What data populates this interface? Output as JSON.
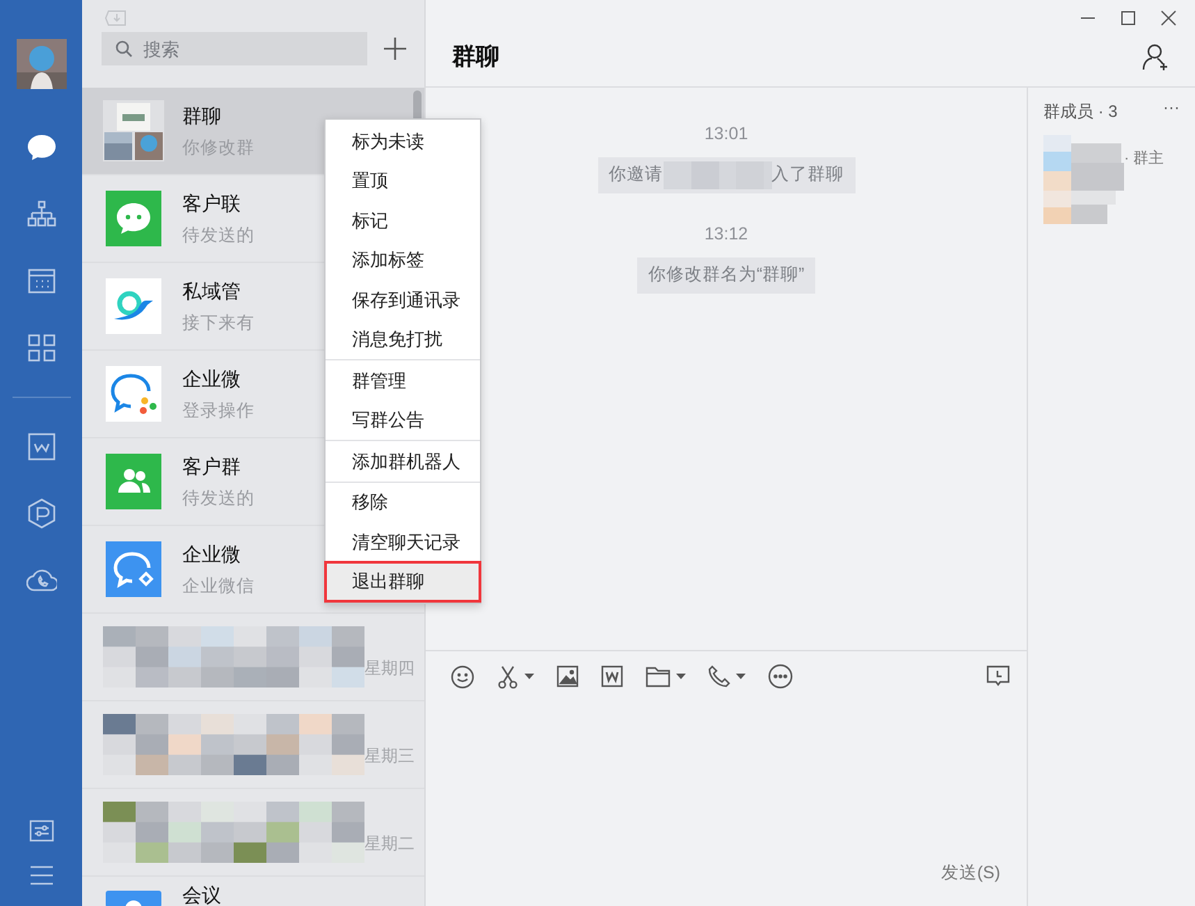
{
  "rail": {
    "items": [
      {
        "selected": true
      },
      {
        "selected": false
      },
      {
        "selected": false
      },
      {
        "selected": false
      },
      {
        "selected": false
      },
      {
        "selected": false
      },
      {
        "selected": false
      }
    ]
  },
  "search": {
    "placeholder": "搜索"
  },
  "chats": [
    {
      "kind": "group",
      "name": "群聊",
      "preview": "你修改群",
      "selected": true
    },
    {
      "kind": "chat",
      "name": "客户联",
      "preview": "待发送的",
      "selected": false
    },
    {
      "kind": "bird",
      "name": "私域管",
      "preview": "接下来有",
      "selected": false
    },
    {
      "kind": "bubble",
      "name": "企业微",
      "preview": "登录操作",
      "selected": false
    },
    {
      "kind": "people",
      "name": "客户群",
      "preview": "待发送的",
      "selected": false
    },
    {
      "kind": "bubble-blue",
      "name": "企业微",
      "preview": "企业微信",
      "selected": false
    },
    {
      "kind": "blurred",
      "time": "星期四",
      "selected": false
    },
    {
      "kind": "blurred",
      "time": "星期三",
      "selected": false
    },
    {
      "kind": "blurred",
      "time": "星期二",
      "selected": false
    },
    {
      "kind": "meeting",
      "name": "会议",
      "selected": false
    }
  ],
  "context_menu": {
    "groups": [
      [
        {
          "label": "标为未读",
          "selected": false
        },
        {
          "label": "置顶",
          "selected": false
        },
        {
          "label": "标记",
          "selected": false
        },
        {
          "label": "添加标签",
          "selected": false
        },
        {
          "label": "保存到通讯录",
          "selected": false
        },
        {
          "label": "消息免打扰",
          "selected": false
        }
      ],
      [
        {
          "label": "群管理",
          "selected": false
        },
        {
          "label": "写群公告",
          "selected": false
        }
      ],
      [
        {
          "label": "添加群机器人",
          "selected": false
        }
      ],
      [
        {
          "label": "移除",
          "selected": false
        },
        {
          "label": "清空聊天记录",
          "selected": false
        },
        {
          "label": "退出群聊",
          "selected": true
        }
      ]
    ]
  },
  "chat": {
    "title": "群聊",
    "messages": [
      {
        "time": "13:01",
        "text": "你邀请",
        "text_after": "入了群聊"
      },
      {
        "time": "13:12",
        "text": "你修改群名为“群聊”"
      }
    ],
    "send_label": "发送(S)"
  },
  "members": {
    "title": "群成员 · 3",
    "more": "···",
    "role": "· 群主"
  }
}
